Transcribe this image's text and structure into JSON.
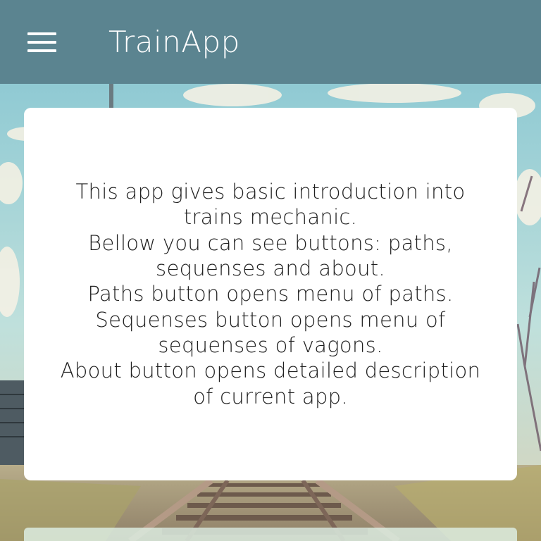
{
  "app_bar": {
    "title": "TrainApp",
    "background": "#5b8490",
    "menu_icon": "hamburger-menu-icon"
  },
  "intro_card": {
    "lines": [
      "This app gives basic introduction into",
      "trains mechanic.",
      "Bellow you can see buttons: paths,",
      "sequenses and about.",
      "Paths button opens menu of paths.",
      "Sequenses button opens menu of",
      "sequenses of vagons.",
      "About button opens detailed description",
      "of current app."
    ]
  },
  "theme": {
    "card_background": "#ffffff",
    "text_color": "#1f1f1f",
    "sky": "#9fd0d8",
    "rail": "#8b6f5a"
  }
}
